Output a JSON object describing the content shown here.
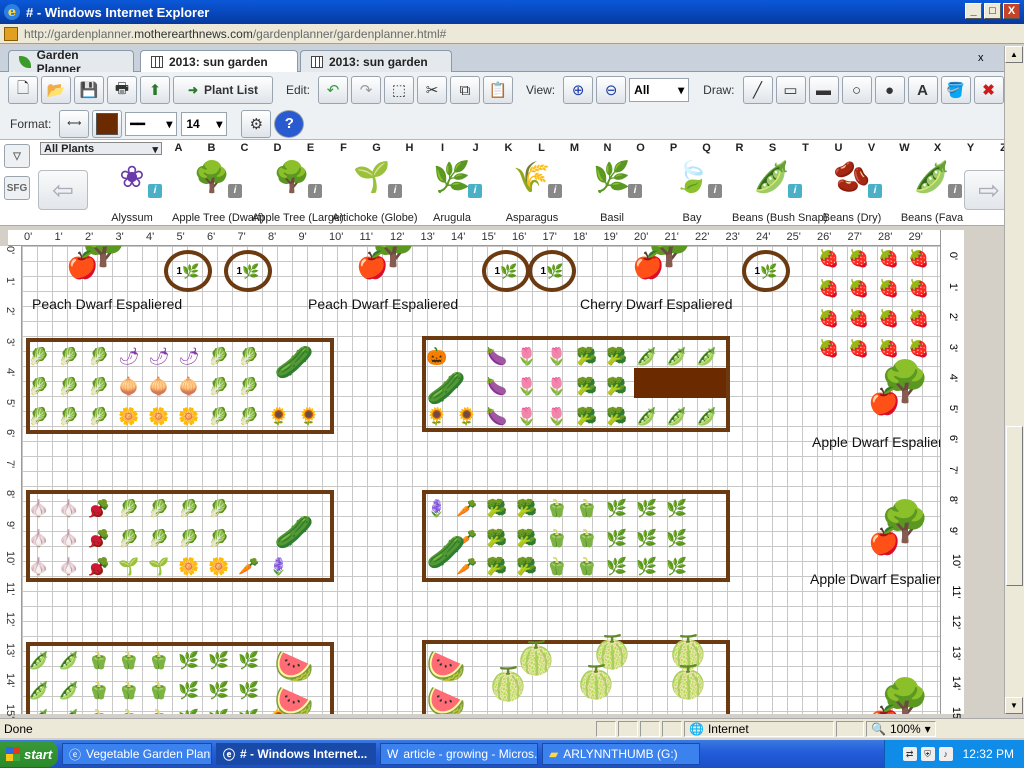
{
  "window": {
    "title": "# - Windows Internet Explorer",
    "min": "_",
    "max": "□",
    "close": "X"
  },
  "address": {
    "prefix": "http://gardenplanner.",
    "domain": "motherearthnews.com",
    "path": "/gardenplanner/gardenplanner.html#"
  },
  "tabs": [
    {
      "label": "Garden Planner"
    },
    {
      "label": "2013: sun garden",
      "close": "x"
    },
    {
      "label": "2013: sun garden"
    }
  ],
  "toolbar": {
    "plant_list_label": "Plant List",
    "edit_label": "Edit:",
    "view_label": "View:",
    "view_select": "All",
    "draw_label": "Draw:",
    "text_tool": "A",
    "format_label": "Format:",
    "font_size": "14",
    "help": "?"
  },
  "plantbar": {
    "filter_label": "All Plants",
    "sfg": "SFG",
    "columns": [
      "A",
      "B",
      "C",
      "D",
      "E",
      "F",
      "G",
      "H",
      "I",
      "J",
      "K",
      "L",
      "M",
      "N",
      "O",
      "P",
      "Q",
      "R",
      "S",
      "T",
      "U",
      "V",
      "W",
      "X",
      "Y",
      "Z"
    ],
    "info": "i",
    "plants": [
      {
        "name": "Alyssum",
        "icon": "❀",
        "info": "teal"
      },
      {
        "name": "Apple Tree (Dwarf)",
        "icon": "🌳",
        "info": "grey"
      },
      {
        "name": "Apple Tree (Large)",
        "icon": "🌳",
        "info": "grey"
      },
      {
        "name": "Artichoke (Globe)",
        "icon": "🌱",
        "info": "grey"
      },
      {
        "name": "Arugula",
        "icon": "🌿",
        "info": "teal"
      },
      {
        "name": "Asparagus",
        "icon": "🌾",
        "info": "grey"
      },
      {
        "name": "Basil",
        "icon": "🌿",
        "info": "grey"
      },
      {
        "name": "Bay",
        "icon": "🍃",
        "info": "grey"
      },
      {
        "name": "Beans (Bush Snap)",
        "icon": "🫛",
        "info": "teal"
      },
      {
        "name": "Beans (Dry)",
        "icon": "🫘",
        "info": "teal"
      },
      {
        "name": "Beans (Fava",
        "icon": "🫛",
        "info": "grey"
      }
    ]
  },
  "ruler": {
    "top": [
      "0'",
      "1'",
      "2'",
      "3'",
      "4'",
      "5'",
      "6'",
      "7'",
      "8'",
      "9'",
      "10'",
      "11'",
      "12'",
      "13'",
      "14'",
      "15'",
      "16'",
      "17'",
      "18'",
      "19'",
      "20'",
      "21'",
      "22'",
      "23'",
      "24'",
      "25'",
      "26'",
      "27'",
      "28'",
      "29'"
    ],
    "left": [
      "0'",
      "1'",
      "2'",
      "3'",
      "4'",
      "5'",
      "6'",
      "7'",
      "8'",
      "9'",
      "10'",
      "11'",
      "12'",
      "13'",
      "14'",
      "15'"
    ],
    "right": [
      "0'",
      "1'",
      "2'",
      "3'",
      "4'",
      "5'",
      "6'",
      "7'",
      "8'",
      "9'",
      "10'",
      "11'",
      "12'",
      "13'",
      "14'",
      "15'"
    ]
  },
  "garden": {
    "labels": [
      "Peach Dwarf Espaliered",
      "Peach Dwarf Espaliered",
      "Cherry Dwarf Espaliered",
      "Apple Dwarf Espaliered",
      "Apple Dwarf Espaliered"
    ],
    "pots": [
      "1",
      "1",
      "1",
      "1",
      "1",
      "1"
    ]
  },
  "status": {
    "done": "Done",
    "zone": "Internet",
    "zoom": "100%"
  },
  "taskbar": {
    "start": "start",
    "tasks": [
      "Vegetable Garden Plann...",
      "# - Windows Internet...",
      "article - growing - Micros...",
      "ARLYNNTHUMB (G:)"
    ],
    "clock": "12:32 PM"
  }
}
